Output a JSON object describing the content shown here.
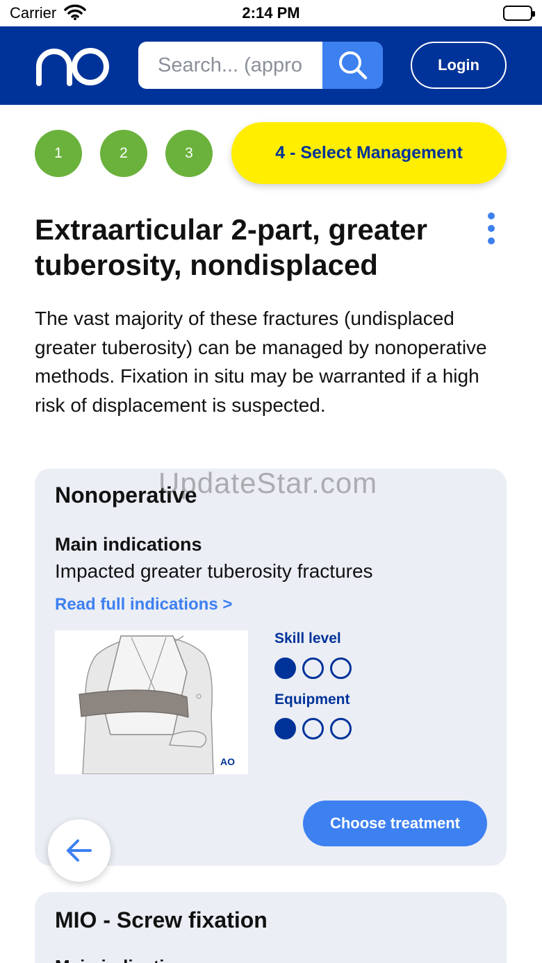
{
  "status_bar": {
    "carrier": "Carrier",
    "time": "2:14 PM"
  },
  "header": {
    "search_placeholder": "Search... (appro",
    "login_label": "Login",
    "brand_color": "#003399",
    "accent_color": "#3d80f0"
  },
  "steps": {
    "items": [
      "1",
      "2",
      "3"
    ],
    "active_label": "4 - Select Management",
    "completed_color": "#6ab23c",
    "active_color": "#ffee00"
  },
  "page": {
    "title": "Extraarticular 2-part, greater tuberosity, nondisplaced",
    "description": "The vast majority of these fractures (undisplaced greater tuberosity) can be managed by nonoperative methods. Fixation in situ may be warranted if a high risk of displacement is suspected."
  },
  "cards": [
    {
      "title": "Nonoperative",
      "main_indications_heading": "Main indications",
      "main_indications_text": "Impacted greater tuberosity fractures",
      "read_more_label": "Read full indications >",
      "skill_level_label": "Skill level",
      "skill_level": {
        "filled": 1,
        "total": 3
      },
      "equipment_label": "Equipment",
      "equipment_level": {
        "filled": 1,
        "total": 3
      },
      "choose_label": "Choose treatment"
    },
    {
      "title": "MIO - Screw fixation",
      "main_indications_heading": "Main indications"
    }
  ],
  "watermark": "UpdateStar.com",
  "icons": {
    "search": "search-icon",
    "more": "more-vertical-icon",
    "back": "arrow-left-icon",
    "wifi": "wifi-icon",
    "battery": "battery-icon",
    "logo": "ao-logo"
  }
}
